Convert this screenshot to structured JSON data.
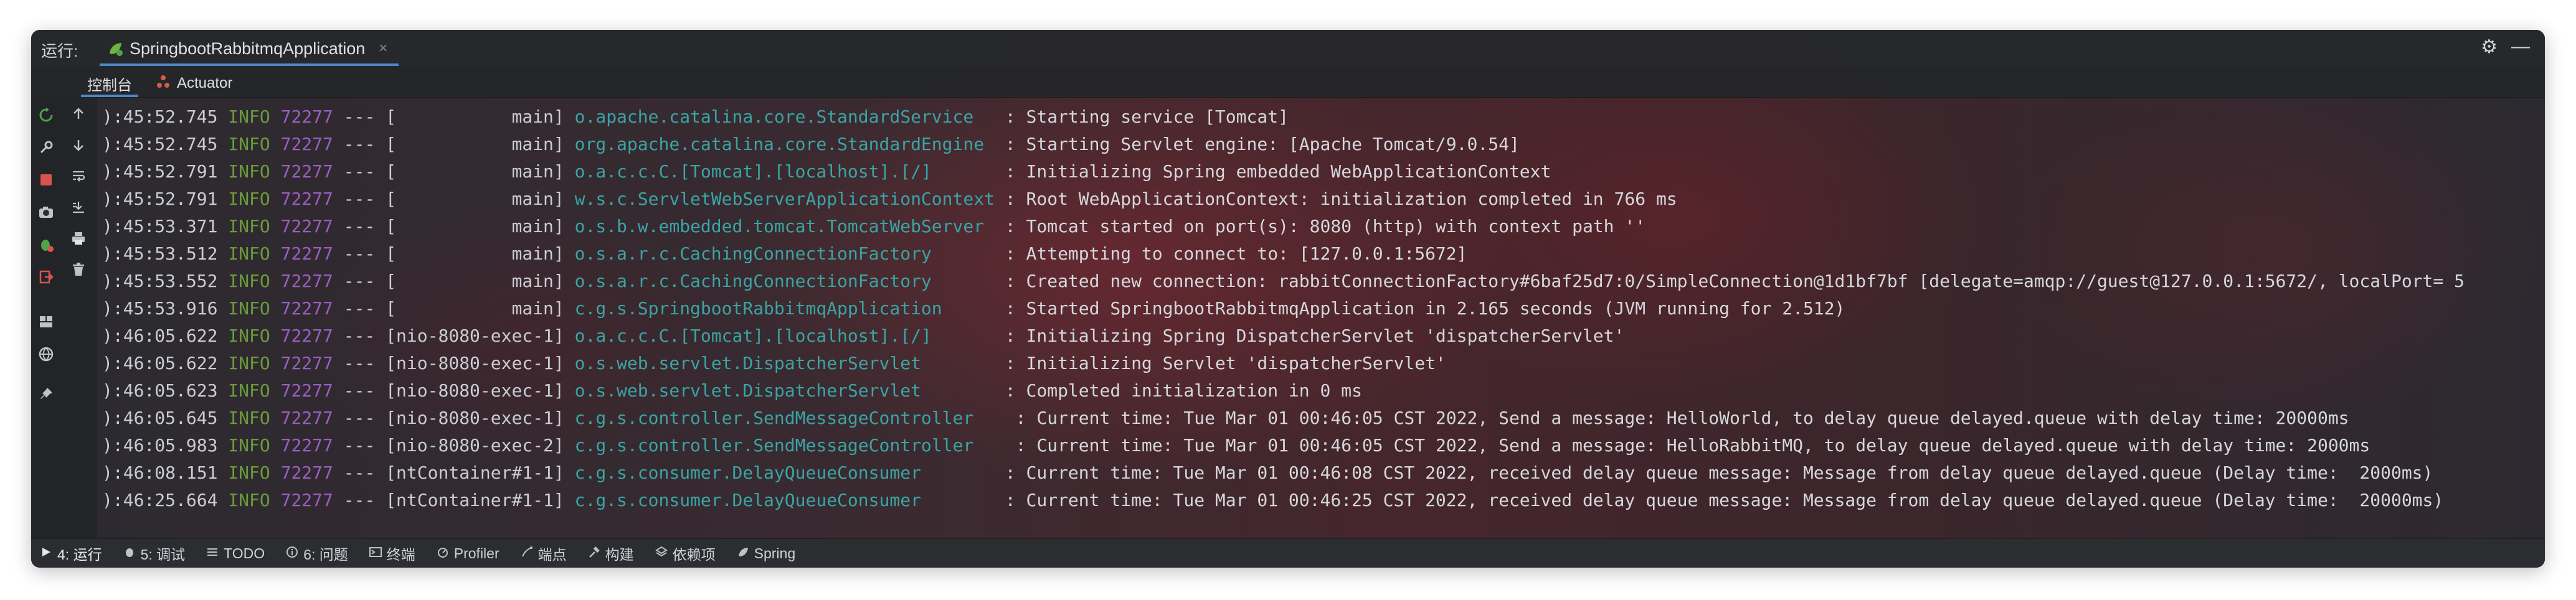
{
  "topbar": {
    "run_label": "运行:",
    "tab_title": "SpringbootRabbitmqApplication",
    "tab_close": "×",
    "gear": "⚙",
    "minimize": "—"
  },
  "subtabs": [
    {
      "label": "控制台"
    },
    {
      "label": "Actuator"
    }
  ],
  "console": {
    "lines": [
      {
        "ts": "):45:52.745",
        "level": "INFO",
        "pid": "72277",
        "sep": "---",
        "thread": "[           main]",
        "logger": "o.apache.catalina.core.StandardService  ",
        "msg": ": Starting service [Tomcat]"
      },
      {
        "ts": "):45:52.745",
        "level": "INFO",
        "pid": "72277",
        "sep": "---",
        "thread": "[           main]",
        "logger": "org.apache.catalina.core.StandardEngine ",
        "msg": ": Starting Servlet engine: [Apache Tomcat/9.0.54]"
      },
      {
        "ts": "):45:52.791",
        "level": "INFO",
        "pid": "72277",
        "sep": "---",
        "thread": "[           main]",
        "logger": "o.a.c.c.C.[Tomcat].[localhost].[/]      ",
        "msg": ": Initializing Spring embedded WebApplicationContext"
      },
      {
        "ts": "):45:52.791",
        "level": "INFO",
        "pid": "72277",
        "sep": "---",
        "thread": "[           main]",
        "logger": "w.s.c.ServletWebServerApplicationContext",
        "msg": ": Root WebApplicationContext: initialization completed in 766 ms"
      },
      {
        "ts": "):45:53.371",
        "level": "INFO",
        "pid": "72277",
        "sep": "---",
        "thread": "[           main]",
        "logger": "o.s.b.w.embedded.tomcat.TomcatWebServer ",
        "msg": ": Tomcat started on port(s): 8080 (http) with context path ''"
      },
      {
        "ts": "):45:53.512",
        "level": "INFO",
        "pid": "72277",
        "sep": "---",
        "thread": "[           main]",
        "logger": "o.s.a.r.c.CachingConnectionFactory      ",
        "msg": ": Attempting to connect to: [127.0.0.1:5672]"
      },
      {
        "ts": "):45:53.552",
        "level": "INFO",
        "pid": "72277",
        "sep": "---",
        "thread": "[           main]",
        "logger": "o.s.a.r.c.CachingConnectionFactory      ",
        "msg": ": Created new connection: rabbitConnectionFactory#6baf25d7:0/SimpleConnection@1d1bf7bf [delegate=amqp://guest@127.0.0.1:5672/, localPort= 5"
      },
      {
        "ts": "):45:53.916",
        "level": "INFO",
        "pid": "72277",
        "sep": "---",
        "thread": "[           main]",
        "logger": "c.g.s.SpringbootRabbitmqApplication     ",
        "msg": ": Started SpringbootRabbitmqApplication in 2.165 seconds (JVM running for 2.512)"
      },
      {
        "ts": "):46:05.622",
        "level": "INFO",
        "pid": "72277",
        "sep": "---",
        "thread": "[nio-8080-exec-1]",
        "logger": "o.a.c.c.C.[Tomcat].[localhost].[/]      ",
        "msg": ": Initializing Spring DispatcherServlet 'dispatcherServlet'"
      },
      {
        "ts": "):46:05.622",
        "level": "INFO",
        "pid": "72277",
        "sep": "---",
        "thread": "[nio-8080-exec-1]",
        "logger": "o.s.web.servlet.DispatcherServlet       ",
        "msg": ": Initializing Servlet 'dispatcherServlet'"
      },
      {
        "ts": "):46:05.623",
        "level": "INFO",
        "pid": "72277",
        "sep": "---",
        "thread": "[nio-8080-exec-1]",
        "logger": "o.s.web.servlet.DispatcherServlet       ",
        "msg": ": Completed initialization in 0 ms"
      },
      {
        "ts": "):46:05.645",
        "level": "INFO",
        "pid": "72277",
        "sep": "---",
        "thread": "[nio-8080-exec-1]",
        "logger": "c.g.s.controller.SendMessageController   ",
        "msg": ": Current time: Tue Mar 01 00:46:05 CST 2022, Send a message: HelloWorld, to delay queue delayed.queue with delay time: 20000ms"
      },
      {
        "ts": "):46:05.983",
        "level": "INFO",
        "pid": "72277",
        "sep": "---",
        "thread": "[nio-8080-exec-2]",
        "logger": "c.g.s.controller.SendMessageController   ",
        "msg": ": Current time: Tue Mar 01 00:46:05 CST 2022, Send a message: HelloRabbitMQ, to delay queue delayed.queue with delay time: 2000ms"
      },
      {
        "ts": "):46:08.151",
        "level": "INFO",
        "pid": "72277",
        "sep": "---",
        "thread": "[ntContainer#1-1]",
        "logger": "c.g.s.consumer.DelayQueueConsumer       ",
        "msg": ": Current time: Tue Mar 01 00:46:08 CST 2022, received delay queue message: Message from delay queue delayed.queue (Delay time:  2000ms)"
      },
      {
        "ts": "):46:25.664",
        "level": "INFO",
        "pid": "72277",
        "sep": "---",
        "thread": "[ntContainer#1-1]",
        "logger": "c.g.s.consumer.DelayQueueConsumer       ",
        "msg": ": Current time: Tue Mar 01 00:46:25 CST 2022, received delay queue message: Message from delay queue delayed.queue (Delay time:  20000ms)"
      }
    ]
  },
  "statusbar": [
    {
      "label": "4: 运行"
    },
    {
      "label": "5: 调试"
    },
    {
      "label": "TODO"
    },
    {
      "label": "6: 问题"
    },
    {
      "label": "终端"
    },
    {
      "label": "Profiler"
    },
    {
      "label": "端点"
    },
    {
      "label": "构建"
    },
    {
      "label": "依赖项"
    },
    {
      "label": "Spring"
    }
  ]
}
